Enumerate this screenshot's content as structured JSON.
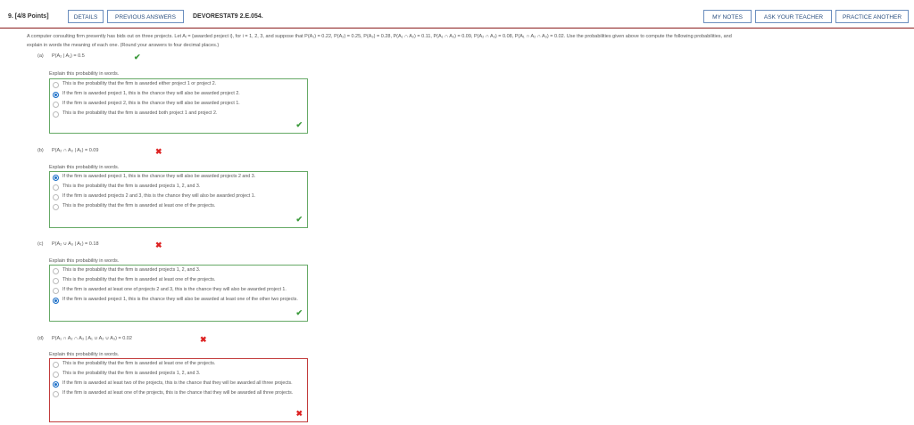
{
  "header": {
    "question_number": "9.",
    "points": "[4/8 Points]",
    "details_label": "DETAILS",
    "previous_answers_label": "PREVIOUS ANSWERS",
    "problem_code": "DEVORESTAT9 2.E.054.",
    "my_notes_label": "MY NOTES",
    "ask_teacher_label": "ASK YOUR TEACHER",
    "practice_another_label": "PRACTICE ANOTHER"
  },
  "intro": {
    "line1": "A computer consulting firm presently has bids out on three projects. Let Aᵢ = {awarded project i}, for i = 1, 2, 3, and suppose that P(A₁) = 0.22, P(A₂) = 0.25, P(A₃) = 0.28, P(A₁ ∩ A₂) = 0.11, P(A₁ ∩ A₃) = 0.09, P(A₂ ∩ A₃) = 0.08, P(A₁ ∩ A₂ ∩ A₃) = 0.02. Use the probabilities given above to compute the following probabilities, and",
    "line2": "explain in words the meaning of each one. (Round your answers to four decimal places.)"
  },
  "parts": [
    {
      "label": "(a)",
      "expression": "P(A₂ | A₁) = 0.5",
      "result": "correct",
      "prompt": "Explain this probability in words.",
      "options": [
        "This is the probability that the firm is awarded either project 1 or project 2.",
        "If the firm is awarded project 1, this is the chance they will also be awarded project 2.",
        "If the firm is awarded project 2, this is the chance they will also be awarded project 1.",
        "This is the probability that the firm is awarded both project 1 and project 2."
      ],
      "selected": 1,
      "option_result": "correct"
    },
    {
      "label": "(b)",
      "expression": "P(A₂ ∩ A₃ | A₁) = 0.09",
      "result": "incorrect",
      "prompt": "Explain this probability in words.",
      "options": [
        "If the firm is awarded project 1, this is the chance they will also be awarded projects 2 and 3.",
        "This is the probability that the firm is awarded projects 1, 2, and 3.",
        "If the firm is awarded projects 2 and 3, this is the chance they will also be awarded project 1.",
        "This is the probability that the firm is awarded at least one of the projects."
      ],
      "selected": 0,
      "option_result": "correct"
    },
    {
      "label": "(c)",
      "expression": "P(A₂ ∪ A₃ | A₁) = 0.18",
      "result": "incorrect",
      "prompt": "Explain this probability in words.",
      "options": [
        "This is the probability that the firm is awarded projects 1, 2, and 3.",
        "This is the probability that the firm is awarded at least one of the projects.",
        "If the firm is awarded at least one of projects 2 and 3, this is the chance they will also be awarded project 1.",
        "If the firm is awarded project 1, this is the chance they will also be awarded at least one of the other two projects."
      ],
      "selected": 3,
      "option_result": "correct"
    },
    {
      "label": "(d)",
      "expression": "P(A₁ ∩ A₂ ∩ A₃ | A₁ ∪ A₂ ∪ A₃) = 0.02",
      "result": "incorrect",
      "prompt": "Explain this probability in words.",
      "options": [
        "This is the probability that the firm is awarded at least one of the projects.",
        "This is the probability that the firm is awarded projects 1, 2, and 3.",
        "If the firm is awarded at least two of the projects, this is the chance that they will be awarded all three projects.",
        "If the firm is awarded at least one of the projects, this is the chance that they will be awarded all three projects."
      ],
      "selected": 2,
      "option_result": "incorrect"
    }
  ],
  "icons": {
    "check": "✔",
    "cross": "✖"
  },
  "colors": {
    "correct": "#3c9a3c",
    "incorrect": "#d22222",
    "accent_rule": "#8a1b1b",
    "button_border": "#6c8fbf"
  }
}
